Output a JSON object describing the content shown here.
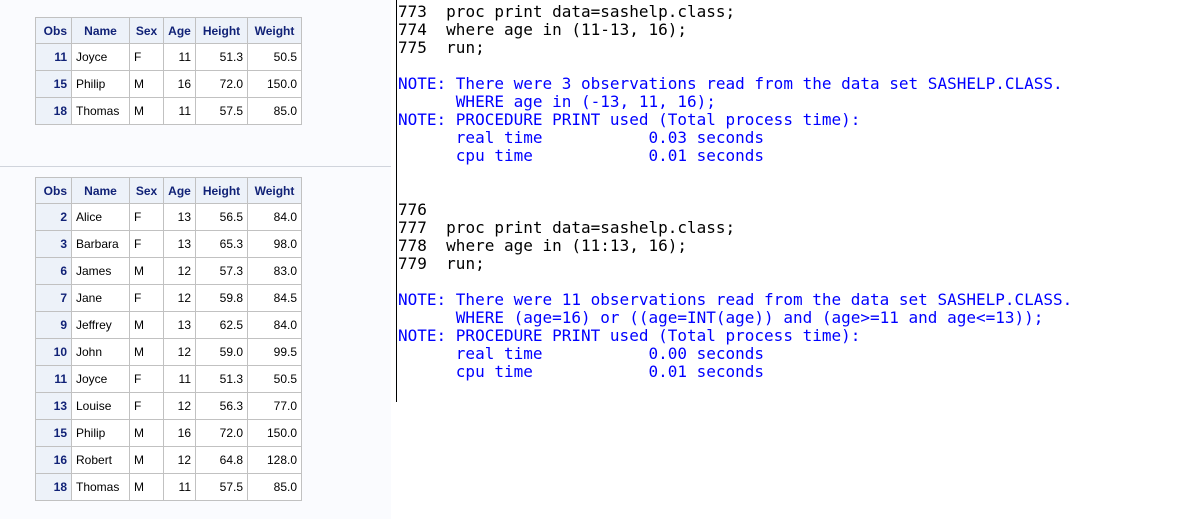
{
  "results": {
    "table1": {
      "headers": [
        "Obs",
        "Name",
        "Sex",
        "Age",
        "Height",
        "Weight"
      ],
      "rows": [
        [
          "11",
          "Joyce",
          "F",
          "11",
          "51.3",
          "50.5"
        ],
        [
          "15",
          "Philip",
          "M",
          "16",
          "72.0",
          "150.0"
        ],
        [
          "18",
          "Thomas",
          "M",
          "11",
          "57.5",
          "85.0"
        ]
      ]
    },
    "table2": {
      "headers": [
        "Obs",
        "Name",
        "Sex",
        "Age",
        "Height",
        "Weight"
      ],
      "rows": [
        [
          "2",
          "Alice",
          "F",
          "13",
          "56.5",
          "84.0"
        ],
        [
          "3",
          "Barbara",
          "F",
          "13",
          "65.3",
          "98.0"
        ],
        [
          "6",
          "James",
          "M",
          "12",
          "57.3",
          "83.0"
        ],
        [
          "7",
          "Jane",
          "F",
          "12",
          "59.8",
          "84.5"
        ],
        [
          "9",
          "Jeffrey",
          "M",
          "13",
          "62.5",
          "84.0"
        ],
        [
          "10",
          "John",
          "M",
          "12",
          "59.0",
          "99.5"
        ],
        [
          "11",
          "Joyce",
          "F",
          "11",
          "51.3",
          "50.5"
        ],
        [
          "13",
          "Louise",
          "F",
          "12",
          "56.3",
          "77.0"
        ],
        [
          "15",
          "Philip",
          "M",
          "16",
          "72.0",
          "150.0"
        ],
        [
          "16",
          "Robert",
          "M",
          "12",
          "64.8",
          "128.0"
        ],
        [
          "18",
          "Thomas",
          "M",
          "11",
          "57.5",
          "85.0"
        ]
      ]
    }
  },
  "log": {
    "block1": {
      "code": [
        {
          "num": "773",
          "text": "proc print data=sashelp.class;"
        },
        {
          "num": "774",
          "text": "where age in (11-13, 16);"
        },
        {
          "num": "775",
          "text": "run;"
        }
      ],
      "notes": [
        "NOTE: There were 3 observations read from the data set SASHELP.CLASS.",
        "      WHERE age in (-13, 11, 16);",
        "NOTE: PROCEDURE PRINT used (Total process time):",
        "      real time           0.03 seconds",
        "      cpu time            0.01 seconds"
      ]
    },
    "block2": {
      "code": [
        {
          "num": "776",
          "text": ""
        },
        {
          "num": "777",
          "text": "proc print data=sashelp.class;"
        },
        {
          "num": "778",
          "text": "where age in (11:13, 16);"
        },
        {
          "num": "779",
          "text": "run;"
        }
      ],
      "notes": [
        "NOTE: There were 11 observations read from the data set SASHELP.CLASS.",
        "      WHERE (age=16) or ((age=INT(age)) and (age>=11 and age<=13));",
        "NOTE: PROCEDURE PRINT used (Total process time):",
        "      real time           0.00 seconds",
        "      cpu time            0.01 seconds"
      ]
    }
  },
  "colors": {
    "note": "#0000ff",
    "header_bg": "#edf2f9",
    "header_text": "#112277"
  }
}
